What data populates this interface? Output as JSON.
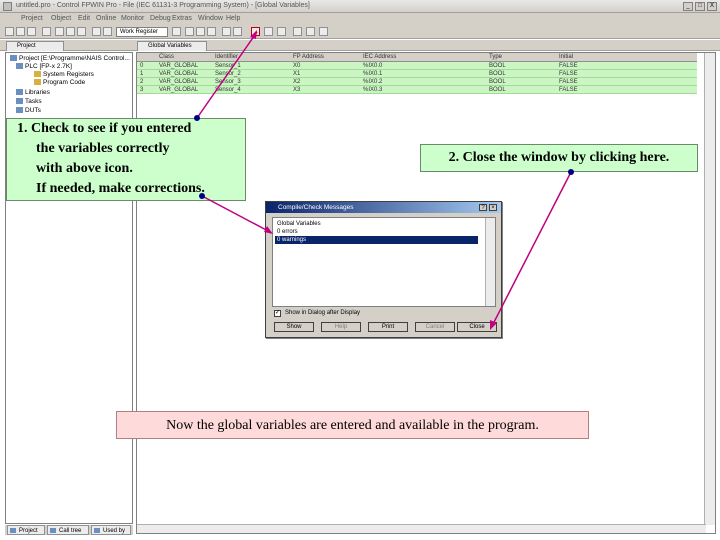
{
  "window": {
    "title": "untitled.pro - Control FPWIN Pro - File (IEC 61131-3 Programming System) - [Global Variables]",
    "controls": [
      "_",
      "□",
      "X"
    ]
  },
  "menu": [
    "Project",
    "Object",
    "Edit",
    "Online",
    "Monitor",
    "Debug",
    "Extras",
    "Window",
    "Help"
  ],
  "toolbar": {
    "combo_value": "Work Register"
  },
  "tabs": {
    "left_tab": "Project",
    "right_tab": "Global Variables"
  },
  "project_tree": [
    {
      "label": "Project [E:\\Programme\\NAIS Control..."
    },
    {
      "label": "PLC [FP-x 2.7K]"
    },
    {
      "label": "System Registers"
    },
    {
      "label": "Program Code"
    },
    {
      "label": "Libraries"
    },
    {
      "label": "Tasks"
    },
    {
      "label": "DUTs"
    }
  ],
  "bottom_tabs": [
    "Project",
    "Call tree",
    "Used by"
  ],
  "grid": {
    "columns": [
      "Class",
      "Identifier",
      "FP Address",
      "IEC Address",
      "Type",
      "Initial"
    ],
    "rows": [
      {
        "num": "0",
        "cls": "VAR_GLOBAL",
        "id": "Sensor_1",
        "fp": "X0",
        "iec": "%IX0.0",
        "type": "BOOL",
        "init": "FALSE"
      },
      {
        "num": "1",
        "cls": "VAR_GLOBAL",
        "id": "Sensor_2",
        "fp": "X1",
        "iec": "%IX0.1",
        "type": "BOOL",
        "init": "FALSE"
      },
      {
        "num": "2",
        "cls": "VAR_GLOBAL",
        "id": "Sensor_3",
        "fp": "X2",
        "iec": "%IX0.2",
        "type": "BOOL",
        "init": "FALSE"
      },
      {
        "num": "3",
        "cls": "VAR_GLOBAL",
        "id": "Sensor_4",
        "fp": "X3",
        "iec": "%IX0.3",
        "type": "BOOL",
        "init": "FALSE"
      }
    ]
  },
  "callouts": {
    "step1": [
      "1. Check to see if you entered",
      "the variables correctly",
      "with above icon.",
      "If needed, make corrections."
    ],
    "step2": "2. Close the window by clicking here.",
    "footer": "Now the global variables are entered and available in the program."
  },
  "dialog": {
    "title": "Compile/Check Messages",
    "messages": [
      "Global Variables",
      "0 errors",
      "0 warnings"
    ],
    "selected_index": 2,
    "checkbox_label": "Show in Dialog after Display",
    "buttons": {
      "show": "Show",
      "help": "Help",
      "print": "Print",
      "cancel": "Cancel",
      "close": "Close"
    }
  }
}
